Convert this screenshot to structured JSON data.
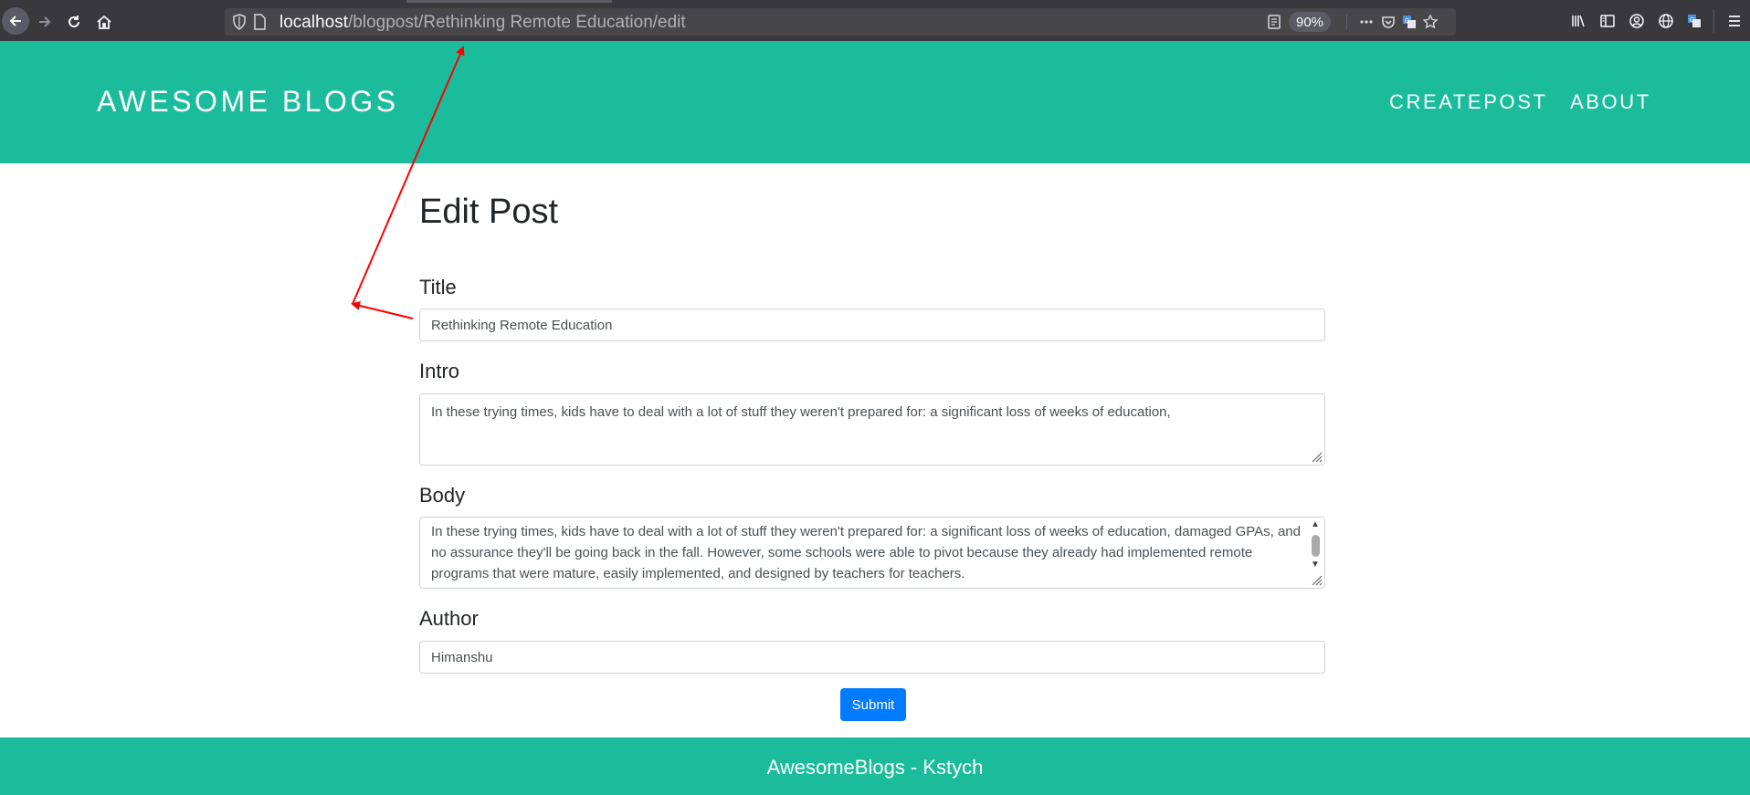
{
  "browser": {
    "url_host": "localhost",
    "url_path": "/blogpost/Rethinking Remote Education/edit",
    "zoom": "90%",
    "icons": [
      "back-arrow-icon",
      "forward-arrow-icon",
      "reload-icon",
      "home-icon",
      "shield-icon",
      "page-icon",
      "reader-view-icon",
      "more-icon",
      "pocket-icon",
      "translate-icon",
      "bookmark-star-icon",
      "library-icon",
      "sidebar-icon",
      "account-icon",
      "globe-icon",
      "translate-icon",
      "hamburger-menu-icon"
    ]
  },
  "header": {
    "brand": "AWESOME BLOGS",
    "nav": {
      "create": "CREATEPOST",
      "about": "ABOUT"
    }
  },
  "form": {
    "heading": "Edit Post",
    "title_label": "Title",
    "title_value": "Rethinking Remote Education",
    "intro_label": "Intro",
    "intro_value": "In these trying times, kids have to deal with a lot of stuff they weren't prepared for: a significant loss of weeks of education,",
    "body_label": "Body",
    "body_value": "In these trying times, kids have to deal with a lot of stuff they weren't prepared for: a significant loss of weeks of education, damaged GPAs, and no assurance they'll be going back in the fall. However, some schools were able to pivot because they already had implemented remote programs that were mature, easily implemented, and designed by teachers for teachers.",
    "author_label": "Author",
    "author_value": "Himanshu",
    "submit_label": "Submit"
  },
  "footer": {
    "text": "AwesomeBlogs - Kstych"
  },
  "colors": {
    "brand": "#1abc9c",
    "button": "#007bff",
    "annotation": "#ff0000",
    "chrome": "#38383d"
  }
}
